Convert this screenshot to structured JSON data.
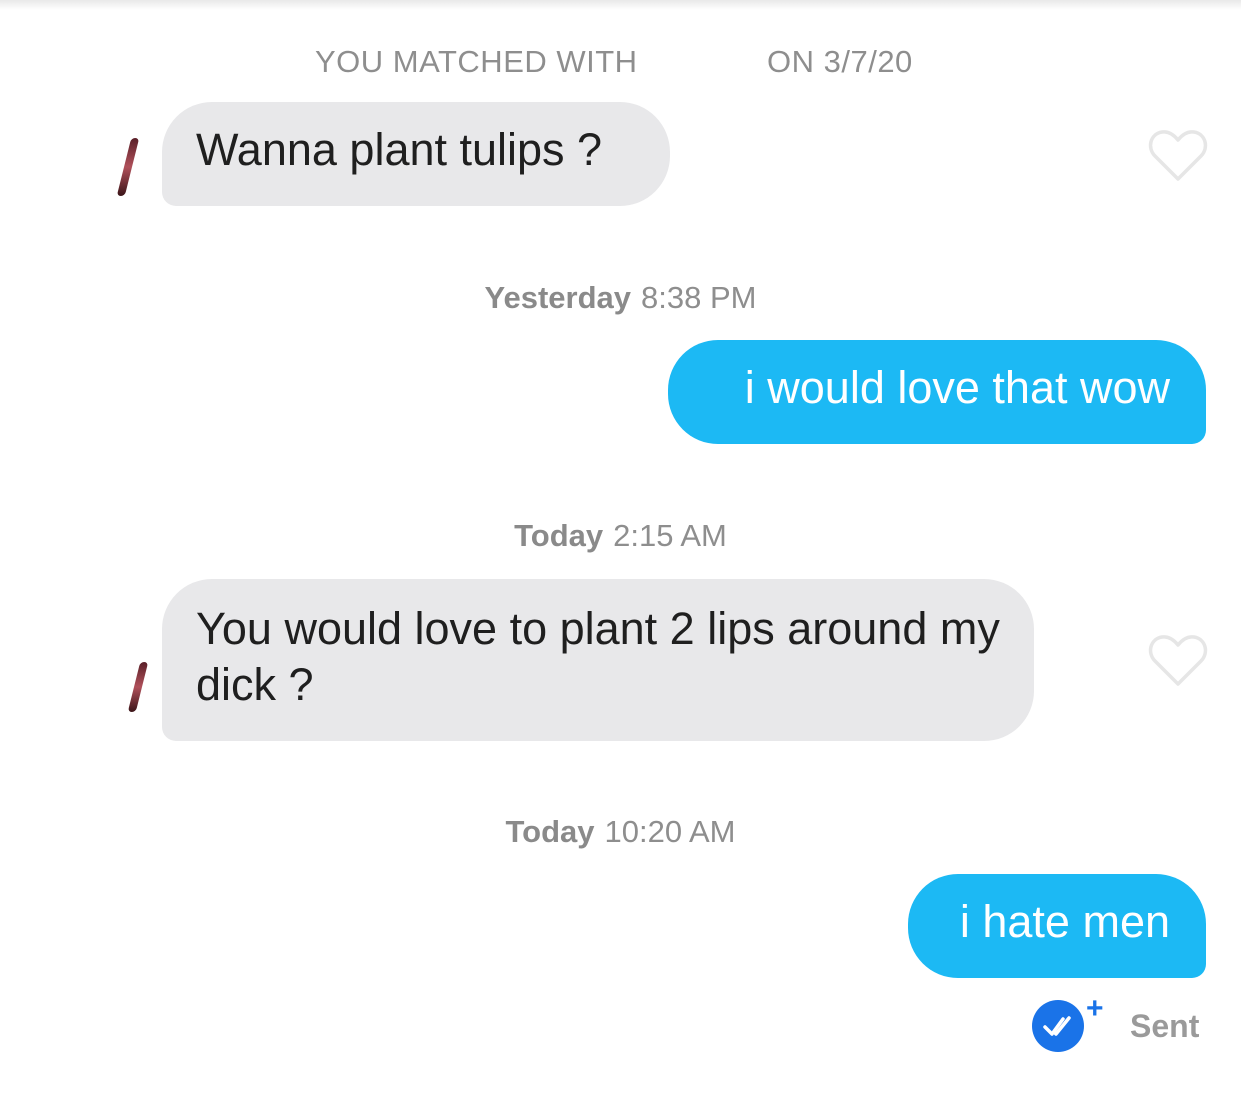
{
  "header": {
    "matched_prefix": "YOU MATCHED WITH",
    "matched_suffix": "ON 3/7/20"
  },
  "messages": [
    {
      "direction": "incoming",
      "text": "Wanna plant tulips ?"
    },
    {
      "timestamp_day": "Yesterday",
      "timestamp_time": "8:38 PM",
      "direction": "outgoing",
      "text": "i would love that wow"
    },
    {
      "timestamp_day": "Today",
      "timestamp_time": "2:15 AM",
      "direction": "incoming",
      "text": "You would love to plant 2 lips around my dick ?"
    },
    {
      "timestamp_day": "Today",
      "timestamp_time": "10:20 AM",
      "direction": "outgoing",
      "text": "i hate men"
    }
  ],
  "status": {
    "label": "Sent",
    "icon": "double-check-icon",
    "badge": "+"
  },
  "colors": {
    "outgoing_bubble": "#1cb9f4",
    "incoming_bubble": "#e8e8ea",
    "read_receipt": "#1a73e8",
    "muted_text": "#8e8e8e"
  }
}
